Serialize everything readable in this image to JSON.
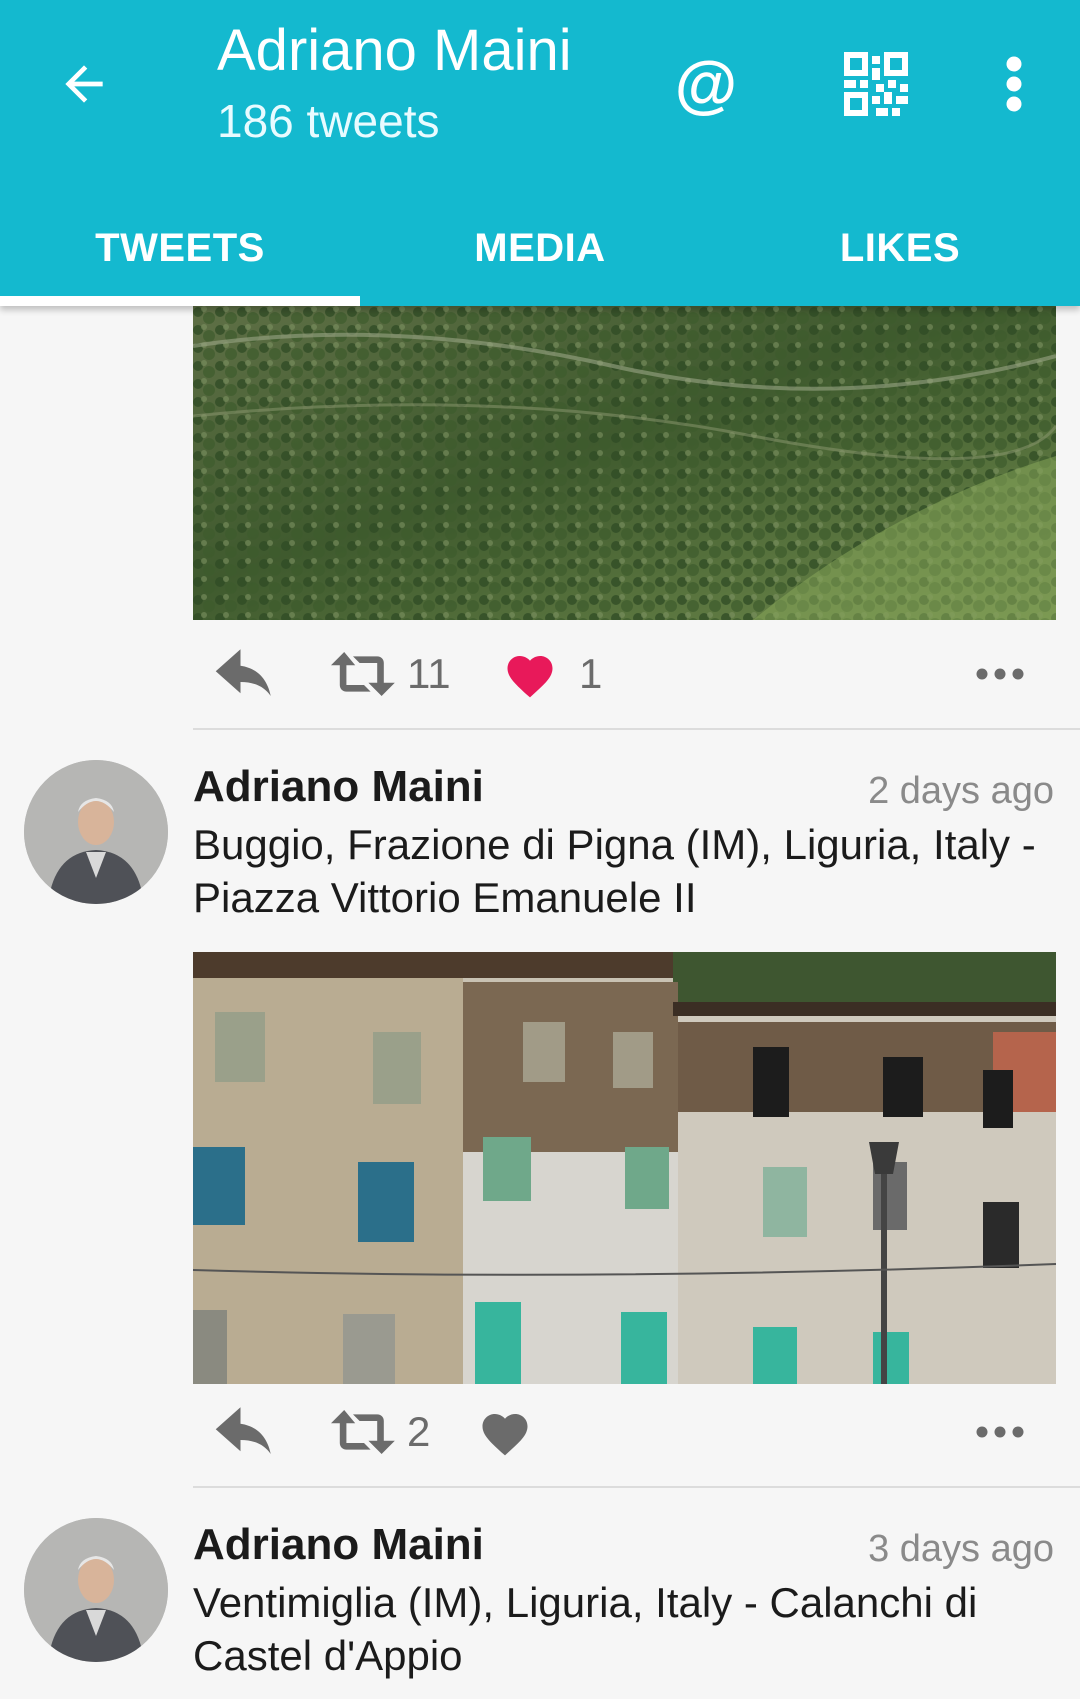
{
  "header": {
    "title": "Adriano Maini",
    "subtitle": "186 tweets",
    "icons": [
      "back-arrow-icon",
      "at-sign-icon",
      "qr-code-icon",
      "more-vert-icon"
    ],
    "at_glyph": "@"
  },
  "tabs": [
    {
      "label": "TWEETS",
      "active": true
    },
    {
      "label": "MEDIA",
      "active": false
    },
    {
      "label": "LIKES",
      "active": false
    }
  ],
  "colors": {
    "accent": "#14b9cf",
    "like_active": "#e8195a",
    "action_gray": "#6b6b6b"
  },
  "tweets": [
    {
      "retweet_count": "11",
      "like_count": "1",
      "liked": true
    },
    {
      "author": "Adriano Maini",
      "time": "2 days ago",
      "text": "Buggio, Frazione di Pigna (IM), Liguria, Italy - Piazza Vittorio Emanuele II",
      "retweet_count": "2",
      "like_count": "",
      "liked": false
    },
    {
      "author": "Adriano Maini",
      "time": "3 days ago",
      "text": "Ventimiglia (IM), Liguria, Italy - Calanchi di Castel d'Appio"
    }
  ]
}
